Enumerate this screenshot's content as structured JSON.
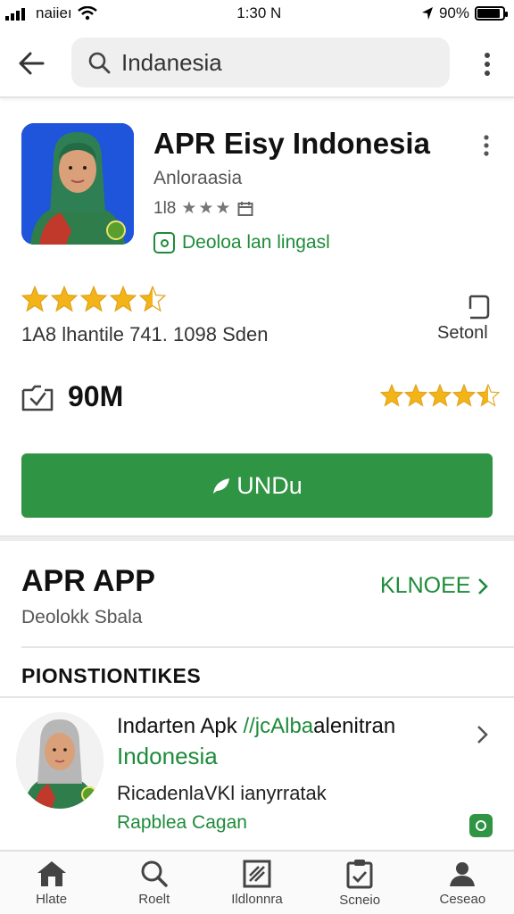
{
  "status_bar": {
    "carrier": "naiieı",
    "time": "1:30 N",
    "battery": "90%",
    "battery_level": 0.9
  },
  "search": {
    "query": "Indanesia"
  },
  "app": {
    "title": "APR Eisy Indonesia",
    "developer": "Anloraasia",
    "meta_count": "1l8",
    "meta_stars": "★★★",
    "tag": "Deoloa lan lingasl",
    "rating": 4.5,
    "rating_text": "1A8 lhantile  741. 1098 Sden",
    "side_label": "Setonl",
    "size": "90M",
    "small_rating": 4.5,
    "install_label": "UNDu"
  },
  "section": {
    "title": "APR APP",
    "link": "KLNOEE",
    "subtitle": "Deolokk Sbala",
    "sub_header": "PIONSTIONTIKES"
  },
  "list_item": {
    "title_plain": "Indarten Apk ",
    "title_highlight": "//jcAlba",
    "title_end": "alenitran",
    "subtitle": "Indonesia",
    "description": "RicadenlaVKl ianyrratak",
    "meta": "Rapblea Cagan"
  },
  "bottom_nav": [
    {
      "label": "Hlate",
      "icon": "home-icon"
    },
    {
      "label": "Roelt",
      "icon": "search-icon"
    },
    {
      "label": "Ildlonnra",
      "icon": "apps-icon"
    },
    {
      "label": "Scneio",
      "icon": "clipboard-icon"
    },
    {
      "label": "Ceseao",
      "icon": "account-icon"
    }
  ],
  "colors": {
    "accent_green": "#2f9443",
    "text_green": "#1e8b3a",
    "star_gold": "#f2b418"
  }
}
